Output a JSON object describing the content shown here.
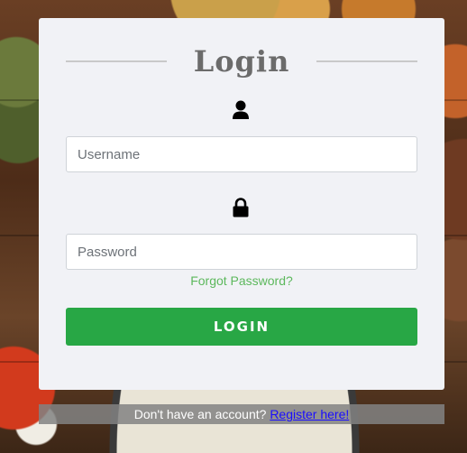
{
  "login_card": {
    "title": "Login",
    "username": {
      "icon": "user-icon",
      "placeholder": "Username",
      "value": ""
    },
    "password": {
      "icon": "lock-icon",
      "placeholder": "Password",
      "value": ""
    },
    "forgot_password": "Forgot Password?",
    "login_button": "LOGIN"
  },
  "register": {
    "prompt": "Don't have an account?",
    "link": "Register here!"
  },
  "colors": {
    "accent_green": "#28a745",
    "link_green": "#5cb85c",
    "card_bg": "#f1f2f6",
    "register_link": "#1a0dff"
  }
}
